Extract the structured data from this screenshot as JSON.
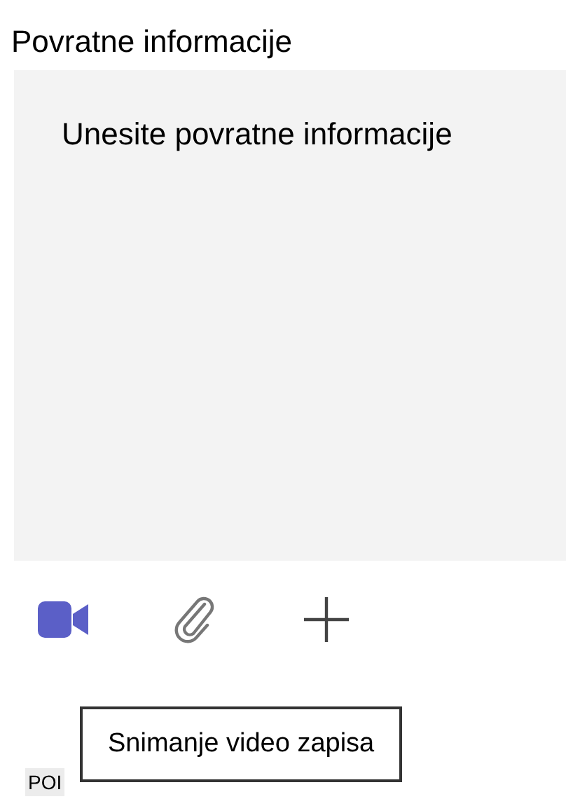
{
  "feedback": {
    "label": "Povratne informacije",
    "placeholder": "Unesite povratne informacije"
  },
  "toolbar": [
    {
      "kind": "video"
    },
    {
      "kind": "attach"
    },
    {
      "kind": "add"
    }
  ],
  "tooltip": "Snimanje video zapisa",
  "badge": "POI"
}
